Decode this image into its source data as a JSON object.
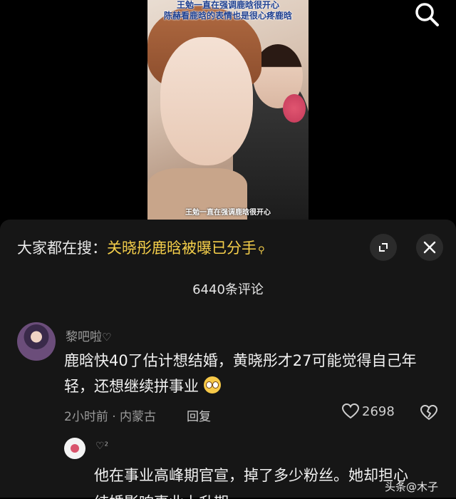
{
  "video": {
    "caption_top_line1": "王勉一直在强调鹿晗很开心",
    "caption_top_line2": "陈赫看鹿晗的表情也是很心疼鹿晗",
    "caption_bottom": "王勉一直在强调鹿晗很开心",
    "search_icon": "search-icon"
  },
  "hot_search": {
    "label": "大家都在搜：",
    "keyword": "关晓彤鹿晗被曝已分手",
    "icon": "search-icon"
  },
  "buttons": {
    "expand_icon": "expand-icon",
    "close_icon": "close-icon"
  },
  "comments_count": "6440条评论",
  "comment": {
    "author": "黎吧啦",
    "author_heart": "♡",
    "text": "鹿晗快40了估计想结婚，黄晓彤才27可能觉得自己年轻，还想继续拼事业",
    "time_location": "2小时前 · 内蒙古",
    "reply_label": "回复",
    "likes": "2698"
  },
  "reply": {
    "likes_badge": "♡²",
    "text_line1": "他在事业高峰期官宣，掉了多少粉丝。她却担心",
    "text_line2": "结婚影响事业上升期"
  },
  "watermark": "头条@木子",
  "colors": {
    "accent": "#f5cf4a",
    "sheet_bg": "#161616",
    "text": "#f2f2f2",
    "muted": "#9a9a9a"
  }
}
